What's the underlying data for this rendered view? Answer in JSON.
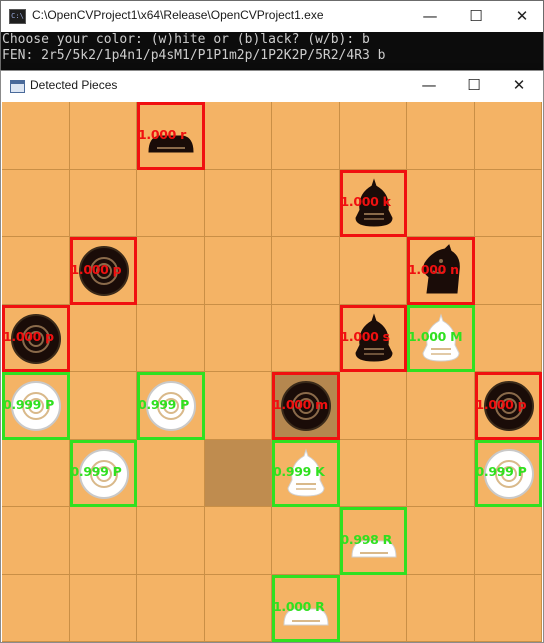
{
  "console": {
    "title": "C:\\OpenCVProject1\\x64\\Release\\OpenCVProject1.exe",
    "icon": "console-app-icon",
    "icon_text": "C:\\",
    "lines": [
      "Choose your color: (w)hite or (b)lack? (w/b): b",
      "FEN: 2r5/5k2/1p4n1/p4sM1/P1P1m2p/1P2K2P/5R2/4R3 b"
    ]
  },
  "detected_window": {
    "title": "Detected Pieces",
    "icon": "window-app-icon"
  },
  "window_controls": {
    "minimize": "—",
    "maximize": "☐",
    "close": "✕"
  },
  "board": {
    "files": 8,
    "ranks": 8,
    "highlight_squares": [
      {
        "file": 3,
        "rank": 5,
        "kind": "dark"
      },
      {
        "file": 4,
        "rank": 4,
        "kind": "brown"
      }
    ],
    "detections": [
      {
        "file": 2,
        "rank": 0,
        "color": "black",
        "piece": "rook",
        "label": "1.000 r"
      },
      {
        "file": 5,
        "rank": 1,
        "color": "black",
        "piece": "king",
        "label": "1.000 k"
      },
      {
        "file": 1,
        "rank": 2,
        "color": "black",
        "piece": "pawn",
        "label": "1.000 p"
      },
      {
        "file": 6,
        "rank": 2,
        "color": "black",
        "piece": "knight",
        "label": "1.000 n"
      },
      {
        "file": 0,
        "rank": 3,
        "color": "black",
        "piece": "pawn",
        "label": "1.000 p"
      },
      {
        "file": 5,
        "rank": 3,
        "color": "black",
        "piece": "advisor",
        "label": "1.000 s"
      },
      {
        "file": 6,
        "rank": 3,
        "color": "white",
        "piece": "queen",
        "label": "1.000 M"
      },
      {
        "file": 0,
        "rank": 4,
        "color": "white",
        "piece": "pawn",
        "label": "0.999 P"
      },
      {
        "file": 2,
        "rank": 4,
        "color": "white",
        "piece": "pawn",
        "label": "0.999 P"
      },
      {
        "file": 4,
        "rank": 4,
        "color": "black",
        "piece": "pawn",
        "label": "1.000 m"
      },
      {
        "file": 7,
        "rank": 4,
        "color": "black",
        "piece": "pawn",
        "label": "1.000 p"
      },
      {
        "file": 1,
        "rank": 5,
        "color": "white",
        "piece": "pawn",
        "label": "0.999 P"
      },
      {
        "file": 4,
        "rank": 5,
        "color": "white",
        "piece": "king",
        "label": "0.999 K"
      },
      {
        "file": 7,
        "rank": 5,
        "color": "white",
        "piece": "pawn",
        "label": "0.999 P"
      },
      {
        "file": 5,
        "rank": 6,
        "color": "white",
        "piece": "rook",
        "label": "0.998 R"
      },
      {
        "file": 4,
        "rank": 7,
        "color": "white",
        "piece": "rook",
        "label": "1.000 R"
      }
    ],
    "colors": {
      "board": "#f4b365",
      "grid": "#c98f46",
      "black_box": "#f01010",
      "white_box": "#30e020"
    }
  }
}
